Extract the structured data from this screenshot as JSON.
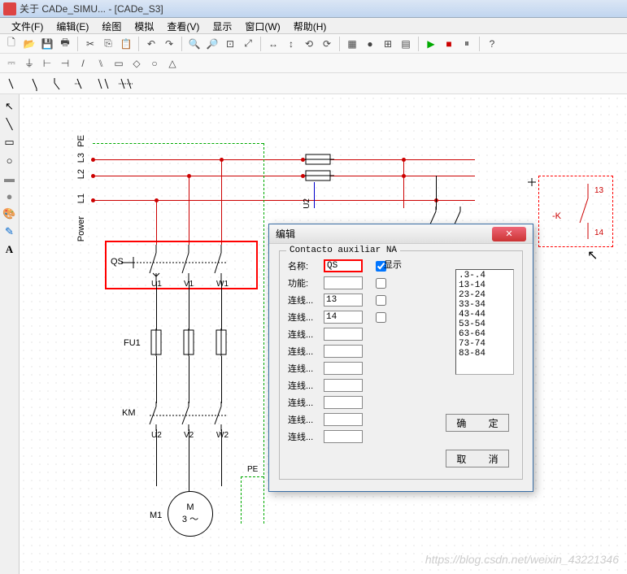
{
  "title": "关于 CADe_SIMU... - [CADe_S3]",
  "menu": [
    "文件(F)",
    "编辑(E)",
    "绘图",
    "模拟",
    "查看(V)",
    "显示",
    "窗口(W)",
    "帮助(H)"
  ],
  "labels": {
    "PE": "PE",
    "L3": "L3",
    "L2": "L2",
    "L1": "L1",
    "Power": "Power",
    "QS": "QS",
    "U1": "U1",
    "V1": "V1",
    "W1": "W1",
    "U2_top": "U2",
    "FU1": "FU1",
    "KM": "KM",
    "U2": "U2",
    "V2": "V2",
    "W2": "W2",
    "PE2": "PE",
    "M1": "M1",
    "M": "M",
    "M3": "3 ～",
    "K": "-K",
    "K13": "13",
    "K14": "14"
  },
  "dialog": {
    "title": "编辑",
    "group": "Contacto auxiliar NA",
    "showlabel": "显示",
    "fields": {
      "name_label": "名称:",
      "name_value": "QS",
      "func_label": "功能:",
      "func_value": "",
      "c1_label": "连线...",
      "c1_value": "13",
      "c2_label": "连线...",
      "c2_value": "14",
      "c3_label": "连线...",
      "c3_value": "",
      "c4_label": "连线...",
      "c4_value": "",
      "c5_label": "连线...",
      "c5_value": "",
      "c6_label": "连线...",
      "c6_value": "",
      "c7_label": "连线...",
      "c7_value": "",
      "c8_label": "连线...",
      "c8_value": "",
      "c9_label": "连线...",
      "c9_value": ""
    },
    "list": [
      ".3-.4",
      "13-14",
      "23-24",
      "33-34",
      "43-44",
      "53-54",
      "63-64",
      "73-74",
      "83-84"
    ],
    "ok": "确   定",
    "cancel": "取   消"
  },
  "watermark": "https://blog.csdn.net/weixin_43221346"
}
